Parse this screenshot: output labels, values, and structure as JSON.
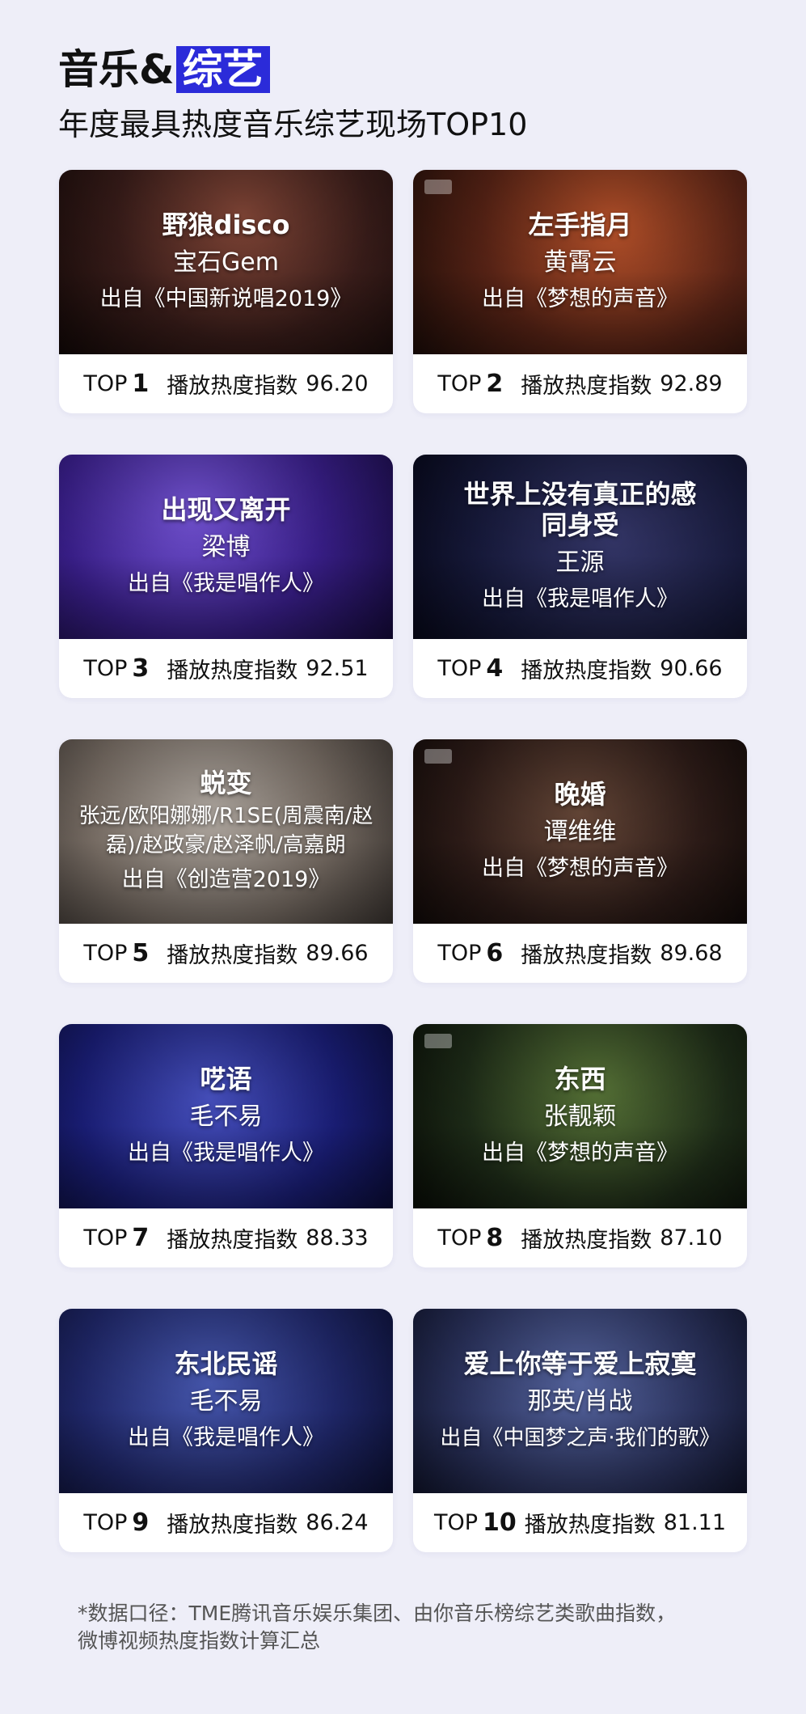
{
  "header": {
    "title_prefix": "音乐&",
    "title_highlight": "综艺",
    "subtitle": "年度最具热度音乐综艺现场TOP10"
  },
  "labels": {
    "top": "TOP",
    "index": "播放热度指数"
  },
  "cards": [
    {
      "song": "野狼disco",
      "artist": "宝石Gem",
      "from": "出自《中国新说唱2019》",
      "rank": "1",
      "value": "96.20"
    },
    {
      "song": "左手指月",
      "artist": "黄霄云",
      "from": "出自《梦想的声音》",
      "rank": "2",
      "value": "92.89"
    },
    {
      "song": "出现又离开",
      "artist": "梁博",
      "from": "出自《我是唱作人》",
      "rank": "3",
      "value": "92.51"
    },
    {
      "song": "世界上没有真正的感同身受",
      "artist": "王源",
      "from": "出自《我是唱作人》",
      "rank": "4",
      "value": "90.66"
    },
    {
      "song": "蜕变",
      "artist": "张远/欧阳娜娜/R1SE(周震南/赵磊)/赵政豪/赵泽帆/高嘉朗",
      "from": "出自《创造营2019》",
      "rank": "5",
      "value": "89.66"
    },
    {
      "song": "晚婚",
      "artist": "谭维维",
      "from": "出自《梦想的声音》",
      "rank": "6",
      "value": "89.68"
    },
    {
      "song": "呓语",
      "artist": "毛不易",
      "from": "出自《我是唱作人》",
      "rank": "7",
      "value": "88.33"
    },
    {
      "song": "东西",
      "artist": "张靓颖",
      "from": "出自《梦想的声音》",
      "rank": "8",
      "value": "87.10"
    },
    {
      "song": "东北民谣",
      "artist": "毛不易",
      "from": "出自《我是唱作人》",
      "rank": "9",
      "value": "86.24"
    },
    {
      "song": "爱上你等于爱上寂寞",
      "artist": "那英/肖战",
      "from": "出自《中国梦之声·我们的歌》",
      "rank": "10",
      "value": "81.11"
    }
  ],
  "footnote": {
    "line1": "*数据口径：TME腾讯音乐娱乐集团、由你音乐榜综艺类歌曲指数，",
    "line2": "微博视频热度指数计算汇总"
  }
}
